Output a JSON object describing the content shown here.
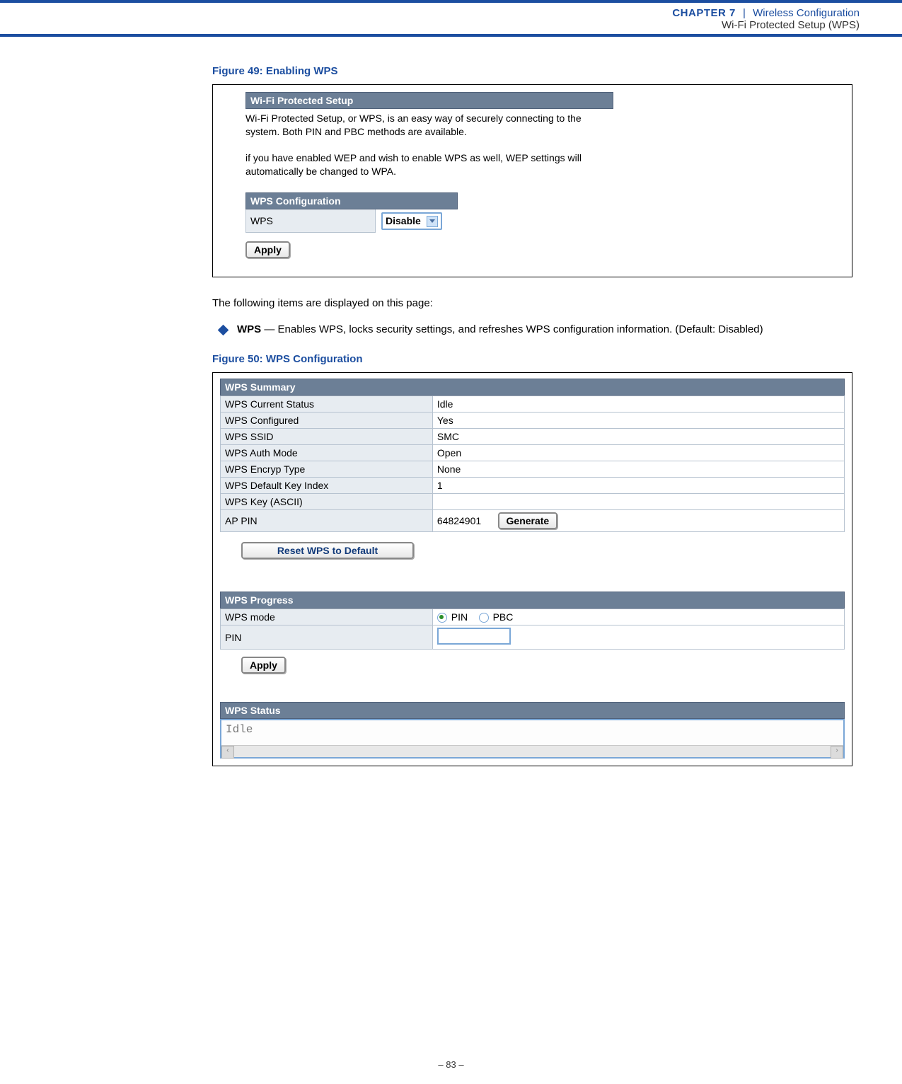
{
  "header": {
    "chapter": "CHAPTER 7",
    "sep": "|",
    "title": "Wireless Configuration",
    "subtitle": "Wi-Fi Protected Setup (WPS)"
  },
  "fig49": {
    "caption": "Figure 49:  Enabling WPS",
    "section1_title": "Wi-Fi Protected Setup",
    "desc1": "Wi-Fi Protected Setup, or WPS, is an easy way of securely connecting to the system. Both PIN and PBC methods are available.",
    "desc2": "if you have enabled WEP and wish to enable WPS as well, WEP settings will automatically be changed to WPA.",
    "section2_title": "WPS Configuration",
    "wps_label": "WPS",
    "wps_value": "Disable",
    "apply": "Apply"
  },
  "para_intro": "The following items are displayed on this page:",
  "bullet": {
    "term": "WPS",
    "text": " — Enables WPS, locks security settings, and refreshes WPS configuration information. (Default: Disabled)"
  },
  "fig50": {
    "caption": "Figure 50:  WPS Configuration",
    "summary_title": "WPS Summary",
    "rows": [
      {
        "label": "WPS Current Status",
        "value": "Idle"
      },
      {
        "label": "WPS Configured",
        "value": "Yes"
      },
      {
        "label": "WPS SSID",
        "value": "SMC"
      },
      {
        "label": "WPS Auth Mode",
        "value": "Open"
      },
      {
        "label": "WPS Encryp Type",
        "value": "None"
      },
      {
        "label": "WPS Default Key Index",
        "value": "1"
      },
      {
        "label": "WPS Key (ASCII)",
        "value": ""
      }
    ],
    "appin_label": "AP PIN",
    "appin_value": "64824901",
    "generate": "Generate",
    "reset": "Reset WPS to Default",
    "progress_title": "WPS Progress",
    "mode_label": "WPS mode",
    "mode_pin": "PIN",
    "mode_pbc": "PBC",
    "pin_label": "PIN",
    "apply": "Apply",
    "status_title": "WPS Status",
    "status_value": "Idle"
  },
  "footer": "–  83  –"
}
